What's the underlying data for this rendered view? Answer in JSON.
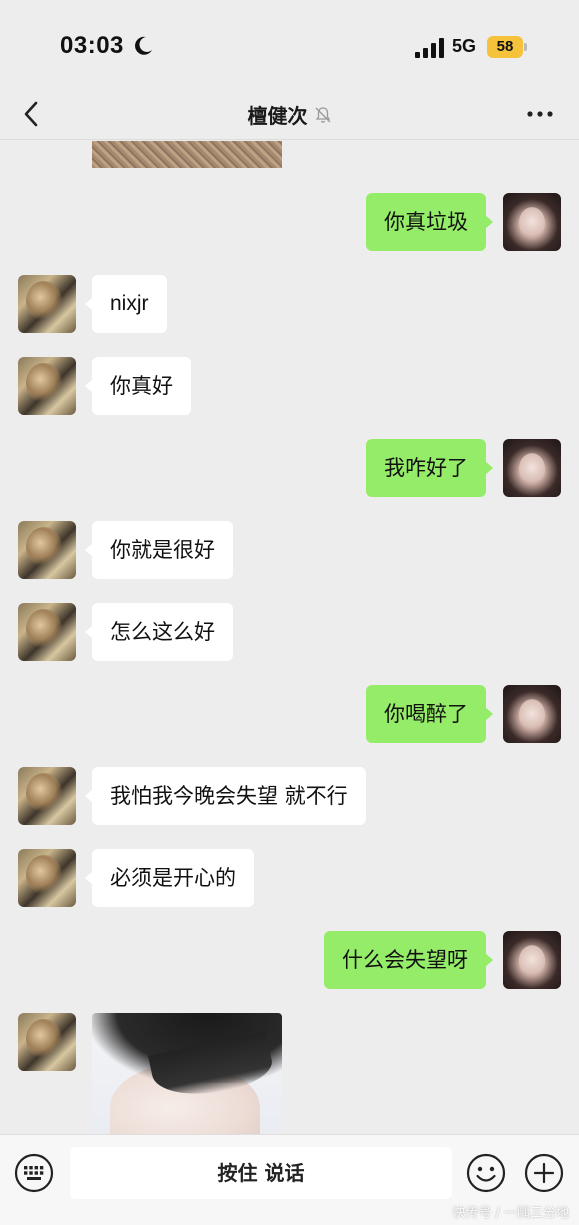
{
  "status": {
    "time": "03:03",
    "network": "5G",
    "battery": "58"
  },
  "nav": {
    "title": "檀健次"
  },
  "messages": [
    {
      "side": "me",
      "text": "你真垃圾"
    },
    {
      "side": "friend",
      "text": "nixjr"
    },
    {
      "side": "friend",
      "text": "你真好"
    },
    {
      "side": "me",
      "text": "我咋好了"
    },
    {
      "side": "friend",
      "text": "你就是很好"
    },
    {
      "side": "friend",
      "text": "怎么这么好"
    },
    {
      "side": "me",
      "text": "你喝醉了"
    },
    {
      "side": "friend",
      "text": "我怕我今晚会失望 就不行"
    },
    {
      "side": "friend",
      "text": "必须是开心的"
    },
    {
      "side": "me",
      "text": "什么会失望呀"
    }
  ],
  "input": {
    "voice_label": "按住 说话"
  },
  "watermark": "快传号 / 一隅三分地",
  "colors": {
    "my_bubble": "#95ec69",
    "friend_bubble": "#ffffff",
    "background": "#ededed",
    "battery": "#f5c33b"
  },
  "icons": [
    "moon-icon",
    "signal-icon",
    "back-icon",
    "mute-icon",
    "more-icon",
    "keyboard-icon",
    "emoji-icon",
    "plus-icon"
  ]
}
